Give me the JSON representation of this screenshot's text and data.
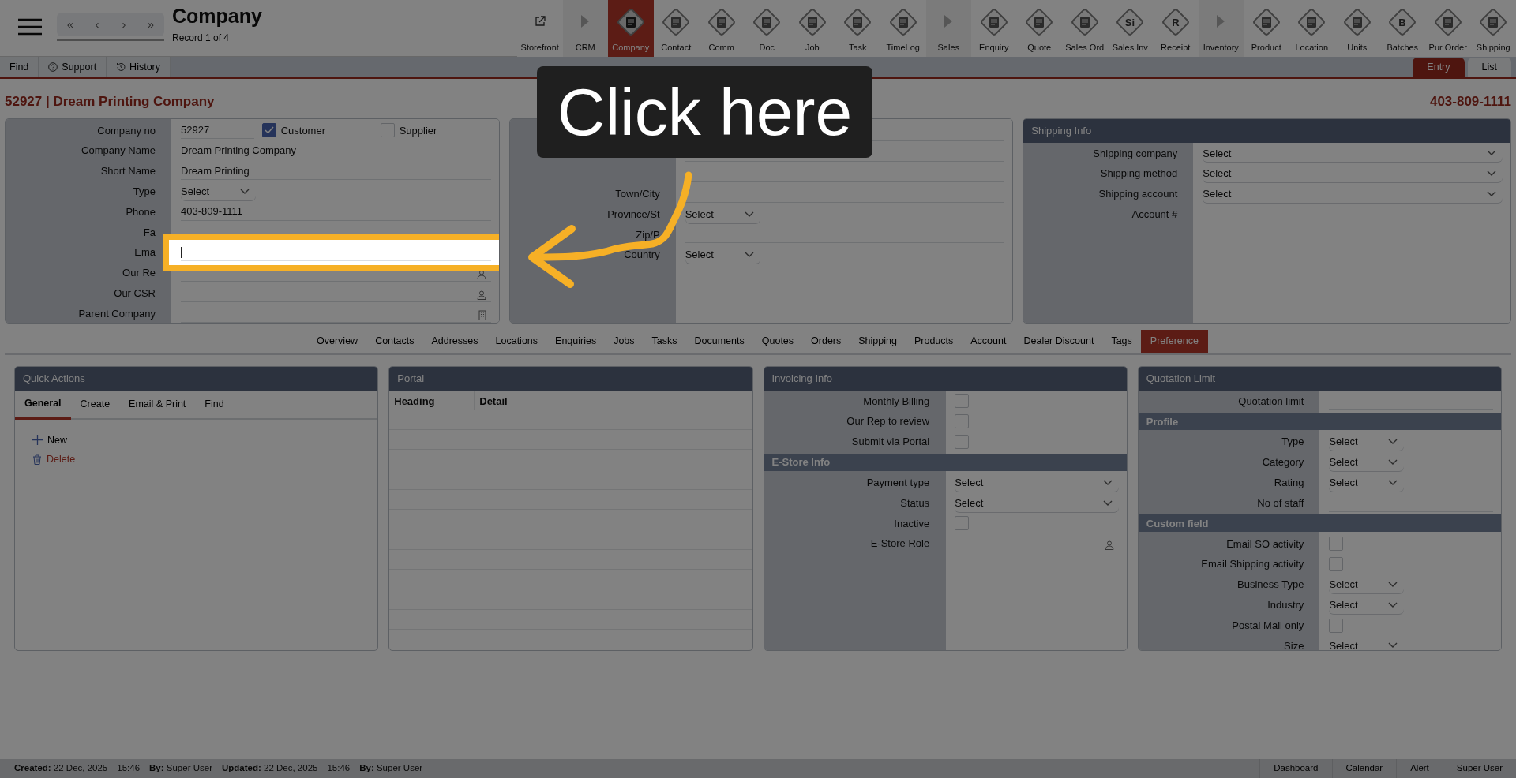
{
  "header": {
    "title": "Company",
    "record": "Record 1 of 4",
    "nav": [
      "«",
      "‹",
      "›",
      "»"
    ]
  },
  "modules": [
    {
      "label": "Storefront",
      "kind": "link",
      "selected": false
    },
    {
      "label": "CRM",
      "kind": "group",
      "selected": false
    },
    {
      "label": "Company",
      "kind": "module",
      "selected": true
    },
    {
      "label": "Contact",
      "kind": "module",
      "selected": false
    },
    {
      "label": "Comm",
      "kind": "module",
      "selected": false
    },
    {
      "label": "Doc",
      "kind": "module",
      "selected": false
    },
    {
      "label": "Job",
      "kind": "module",
      "selected": false
    },
    {
      "label": "Task",
      "kind": "module",
      "selected": false
    },
    {
      "label": "TimeLog",
      "kind": "module",
      "selected": false
    },
    {
      "label": "Sales",
      "kind": "group",
      "selected": false
    },
    {
      "label": "Enquiry",
      "kind": "module",
      "selected": false
    },
    {
      "label": "Quote",
      "kind": "module",
      "selected": false
    },
    {
      "label": "Sales Ord",
      "kind": "module",
      "selected": false
    },
    {
      "label": "Sales Inv",
      "kind": "module",
      "glyph": "Si",
      "selected": false
    },
    {
      "label": "Receipt",
      "kind": "module",
      "glyph": "R",
      "selected": false
    },
    {
      "label": "Inventory",
      "kind": "group",
      "selected": false
    },
    {
      "label": "Product",
      "kind": "module",
      "selected": false
    },
    {
      "label": "Location",
      "kind": "module",
      "selected": false
    },
    {
      "label": "Units",
      "kind": "module",
      "selected": false
    },
    {
      "label": "Batches",
      "kind": "module",
      "glyph": "B",
      "selected": false
    },
    {
      "label": "Pur Order",
      "kind": "module",
      "selected": false
    },
    {
      "label": "Shipping",
      "kind": "module",
      "selected": false
    }
  ],
  "toolbar": [
    {
      "label": "Find",
      "kind": "plain"
    },
    {
      "label": "Support",
      "kind": "help"
    },
    {
      "label": "History",
      "kind": "history"
    }
  ],
  "view_tabs": [
    {
      "label": "Entry",
      "selected": true
    },
    {
      "label": "List",
      "selected": false
    }
  ],
  "record_title": "52927 | Dream Printing Company",
  "record_phone": "403-809-1111",
  "company_card": {
    "rows": [
      {
        "label": "Company no",
        "kind": "text",
        "value": "52927",
        "checks": [
          {
            "label": "Customer",
            "checked": true
          },
          {
            "label": "Supplier",
            "checked": false
          }
        ]
      },
      {
        "label": "Company Name",
        "kind": "text",
        "value": "Dream Printing Company"
      },
      {
        "label": "Short Name",
        "kind": "text",
        "value": "Dream Printing"
      },
      {
        "label": "Type",
        "kind": "select",
        "value": "Select"
      },
      {
        "label": "Phone",
        "kind": "text",
        "value": "403-809-1111"
      },
      {
        "label": "Fa",
        "kind": "text"
      },
      {
        "label": "Ema",
        "kind": "text",
        "highlighted": true
      },
      {
        "label": "Our Re",
        "kind": "person-lookup"
      },
      {
        "label": "Our CSR",
        "kind": "person-lookup"
      },
      {
        "label": "Parent Company",
        "kind": "building-lookup"
      }
    ]
  },
  "address_card": {
    "rows": [
      {
        "kind": "text"
      },
      {
        "kind": "text"
      },
      {
        "kind": "text"
      },
      {
        "label": "Town/City",
        "kind": "text"
      },
      {
        "label": "Province/St",
        "kind": "select",
        "value": "Select"
      },
      {
        "label": "Zip/P",
        "kind": "text"
      },
      {
        "label": "Country",
        "kind": "select",
        "value": "Select"
      }
    ]
  },
  "shipping_card": {
    "title": "Shipping Info",
    "rows": [
      {
        "label": "Shipping company",
        "kind": "select-wide",
        "value": "Select"
      },
      {
        "label": "Shipping method",
        "kind": "select-wide",
        "value": "Select"
      },
      {
        "label": "Shipping account",
        "kind": "select-wide",
        "value": "Select"
      },
      {
        "label": "Account #",
        "kind": "text"
      }
    ]
  },
  "section_tabs": [
    {
      "label": "Overview",
      "selected": false
    },
    {
      "label": "Contacts",
      "selected": false
    },
    {
      "label": "Addresses",
      "selected": false
    },
    {
      "label": "Locations",
      "selected": false
    },
    {
      "label": "Enquiries",
      "selected": false
    },
    {
      "label": "Jobs",
      "selected": false
    },
    {
      "label": "Tasks",
      "selected": false
    },
    {
      "label": "Documents",
      "selected": false
    },
    {
      "label": "Quotes",
      "selected": false
    },
    {
      "label": "Orders",
      "selected": false
    },
    {
      "label": "Shipping",
      "selected": false
    },
    {
      "label": "Products",
      "selected": false
    },
    {
      "label": "Account",
      "selected": false
    },
    {
      "label": "Dealer Discount",
      "selected": false
    },
    {
      "label": "Tags",
      "selected": false
    },
    {
      "label": "Preference",
      "selected": true
    }
  ],
  "quick_actions": {
    "title": "Quick Actions",
    "tabs": [
      {
        "label": "General",
        "selected": true
      },
      {
        "label": "Create",
        "selected": false
      },
      {
        "label": "Email & Print",
        "selected": false
      },
      {
        "label": "Find",
        "selected": false
      }
    ],
    "actions": [
      {
        "label": "New",
        "kind": "add"
      },
      {
        "label": "Delete",
        "kind": "delete"
      }
    ]
  },
  "portal": {
    "title": "Portal",
    "columns": [
      "Heading",
      "Detail"
    ]
  },
  "invoicing": {
    "title": "Invoicing Info",
    "rows": [
      {
        "label": "Monthly Billing",
        "kind": "checkbox",
        "checked": false
      },
      {
        "label": "Our Rep to review",
        "kind": "checkbox",
        "checked": false
      },
      {
        "label": "Submit via Portal",
        "kind": "checkbox",
        "checked": false
      },
      {
        "label": "E-Store Info",
        "kind": "section"
      },
      {
        "label": "Payment type",
        "kind": "select-wide",
        "value": "Select"
      },
      {
        "label": "Status",
        "kind": "select-wide",
        "value": "Select"
      },
      {
        "label": "Inactive",
        "kind": "checkbox",
        "checked": false
      },
      {
        "label": "E-Store Role",
        "kind": "person-lookup"
      }
    ]
  },
  "quotation": {
    "title": "Quotation Limit",
    "rows": [
      {
        "label": "Quotation limit",
        "kind": "text"
      },
      {
        "label": "Profile",
        "kind": "section"
      },
      {
        "label": "Type",
        "kind": "select",
        "value": "Select"
      },
      {
        "label": "Category",
        "kind": "select",
        "value": "Select"
      },
      {
        "label": "Rating",
        "kind": "select",
        "value": "Select"
      },
      {
        "label": "No of staff",
        "kind": "text"
      },
      {
        "label": "Custom field",
        "kind": "section"
      },
      {
        "label": "Email SO activity",
        "kind": "checkbox",
        "checked": false
      },
      {
        "label": "Email Shipping activity",
        "kind": "checkbox",
        "checked": false
      },
      {
        "label": "Business Type",
        "kind": "select",
        "value": "Select"
      },
      {
        "label": "Industry",
        "kind": "select",
        "value": "Select"
      },
      {
        "label": "Postal Mail only",
        "kind": "checkbox",
        "checked": false
      },
      {
        "label": "Size",
        "kind": "select",
        "value": "Select"
      }
    ]
  },
  "footer": {
    "info": [
      {
        "label": "Created:",
        "value": "22 Dec, 2025"
      },
      {
        "value": "15:46"
      },
      {
        "label": "By:",
        "value": "Super User"
      },
      {
        "label": "Updated:",
        "value": "22 Dec, 2025"
      },
      {
        "value": "15:46"
      },
      {
        "label": "By:",
        "value": "Super User"
      }
    ],
    "links": [
      "Dashboard",
      "Calendar",
      "Alert",
      "Super User"
    ]
  },
  "callout": {
    "text": "Click here"
  }
}
